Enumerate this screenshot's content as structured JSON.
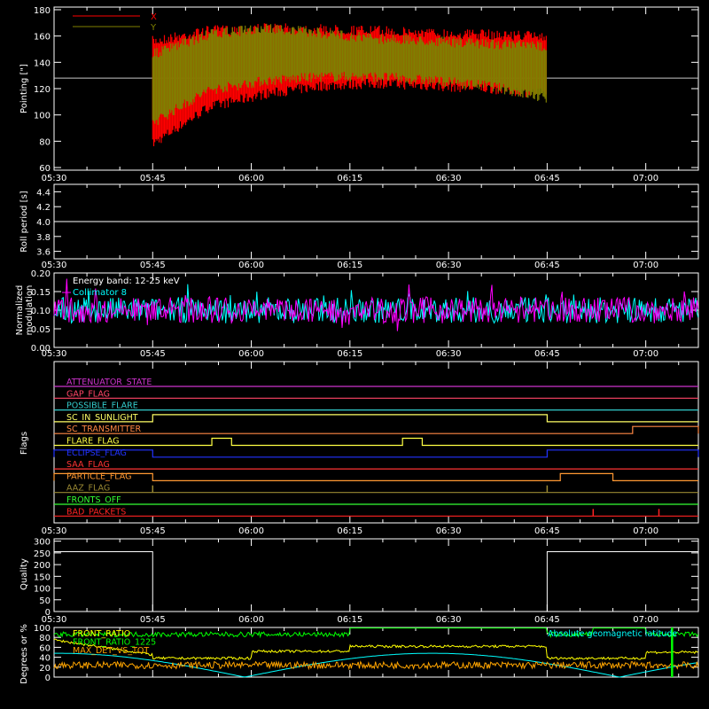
{
  "chart_data": [
    {
      "type": "line",
      "id": "pointing",
      "ylabel": "Pointing [\"]",
      "ylim": [
        58,
        182
      ],
      "yticks": [
        60,
        80,
        100,
        120,
        140,
        160,
        180
      ],
      "x_tick_labels": [
        "05:30",
        "05:45",
        "06:00",
        "06:15",
        "06:30",
        "06:45",
        "07:00"
      ],
      "reference_line": 128,
      "series": [
        {
          "name": "X",
          "color": "#ff0000",
          "data_range_min": [
            "05:45",
            "06:45"
          ],
          "upper_envelope": [
            160,
            168,
            170,
            169,
            168,
            166,
            165,
            164
          ],
          "lower_envelope": [
            74,
            102,
            112,
            118,
            120,
            118,
            116,
            112
          ]
        },
        {
          "name": "Y",
          "color": "#808000",
          "upper_envelope": [
            150,
            165,
            170,
            166,
            162,
            160,
            158,
            156
          ],
          "lower_envelope": [
            90,
            115,
            122,
            125,
            125,
            122,
            118,
            108
          ]
        }
      ],
      "active_range": [
        "05:45",
        "06:45"
      ]
    },
    {
      "type": "line",
      "id": "roll",
      "ylabel": "Roll period [s]",
      "ylim": [
        3.5,
        4.5
      ],
      "yticks": [
        "3.6",
        "3.8",
        "4.0",
        "4.2",
        "4.4"
      ],
      "yvals": [
        3.6,
        3.8,
        4.0,
        4.2,
        4.4
      ],
      "x_tick_labels": [
        "05:30",
        "05:45",
        "06:00",
        "06:15",
        "06:30",
        "06:45",
        "07:00"
      ],
      "series": [
        {
          "color": "#ffffff",
          "constant": 4.0
        }
      ]
    },
    {
      "type": "line",
      "id": "modulation",
      "ylabel": [
        "Normalized",
        "modulation"
      ],
      "ylim": [
        0,
        0.2
      ],
      "yticks": [
        "0.00",
        "0.05",
        "0.10",
        "0.15",
        "0.20"
      ],
      "yvals": [
        0,
        0.05,
        0.1,
        0.15,
        0.2
      ],
      "x_tick_labels": [
        "05:30",
        "05:45",
        "06:00",
        "06:15",
        "06:30",
        "06:45",
        "07:00"
      ],
      "annotation": "Energy band: 12-25 keV",
      "series": [
        {
          "name": "Collimator 8",
          "color": "#00ffff",
          "mean": 0.1,
          "spread": 0.035
        },
        {
          "name": "",
          "color": "#ff00ff",
          "mean": 0.1,
          "spread": 0.035
        }
      ]
    },
    {
      "type": "line",
      "id": "flags",
      "ylabel": "Flags",
      "x_tick_labels": [
        "05:30",
        "05:45",
        "06:00",
        "06:15",
        "06:30",
        "06:45",
        "07:00"
      ],
      "flags": [
        {
          "label": "ATTENUATOR_STATE",
          "color": "#cc33cc"
        },
        {
          "label": "GAP_FLAG",
          "color": "#ff4466"
        },
        {
          "label": "POSSIBLE_FLARE",
          "color": "#33cccc"
        },
        {
          "label": "SC_IN_SUNLIGHT",
          "color": "#ffff66",
          "high": [
            [
              "05:45",
              "06:45"
            ]
          ]
        },
        {
          "label": "SC_TRANSMITTER",
          "color": "#ff8844",
          "high": [
            [
              "06:58",
              "07:08"
            ]
          ]
        },
        {
          "label": "FLARE_FLAG",
          "color": "#ffff44",
          "high": [
            [
              "05:54",
              "05:57"
            ],
            [
              "06:23",
              "06:26"
            ]
          ]
        },
        {
          "label": "ECLIPSE_FLAG",
          "color": "#2233ff",
          "high": [
            [
              "05:30",
              "05:45"
            ],
            [
              "06:45",
              "07:08"
            ]
          ]
        },
        {
          "label": "SAA_FLAG",
          "color": "#ff3333"
        },
        {
          "label": "PARTICLE_FLAG",
          "color": "#ff9933",
          "high": [
            [
              "05:30",
              "05:45"
            ],
            [
              "06:47",
              "06:55"
            ]
          ]
        },
        {
          "label": "AAZ_FLAG",
          "color": "#998833",
          "spikes": [
            "05:45",
            "06:45"
          ]
        },
        {
          "label": "FRONTS_OFF",
          "color": "#33ff33"
        },
        {
          "label": "BAD_PACKETS",
          "color": "#ff2222",
          "spikes": [
            "06:52",
            "07:02"
          ]
        }
      ]
    },
    {
      "type": "line",
      "id": "quality",
      "ylabel": "Quality",
      "ylim": [
        0,
        310
      ],
      "yticks": [
        0,
        50,
        100,
        150,
        200,
        250,
        300
      ],
      "x_tick_labels": [
        "05:30",
        "05:45",
        "06:00",
        "06:15",
        "06:30",
        "06:45",
        "07:00"
      ],
      "series": [
        {
          "color": "#ffffff",
          "value_outside": 255,
          "value_inside": 0,
          "inside_range": [
            "05:45",
            "06:45"
          ]
        }
      ]
    },
    {
      "type": "line",
      "id": "geo",
      "ylabel": "Degrees or %",
      "ylim": [
        0,
        100
      ],
      "yticks": [
        0,
        20,
        40,
        60,
        80,
        100
      ],
      "series": [
        {
          "name": "FRONT_RATIO",
          "color": "#ffff00"
        },
        {
          "name": "FRONT_RATIO_1225",
          "color": "#00ff00"
        },
        {
          "name": "MAX_DET_VS_TOT",
          "color": "#ffa500"
        },
        {
          "name": "Absolute geomagnetic latitude",
          "color": "#00ffff"
        }
      ]
    }
  ],
  "time_axis": {
    "start": "05:30",
    "end": "07:08"
  }
}
